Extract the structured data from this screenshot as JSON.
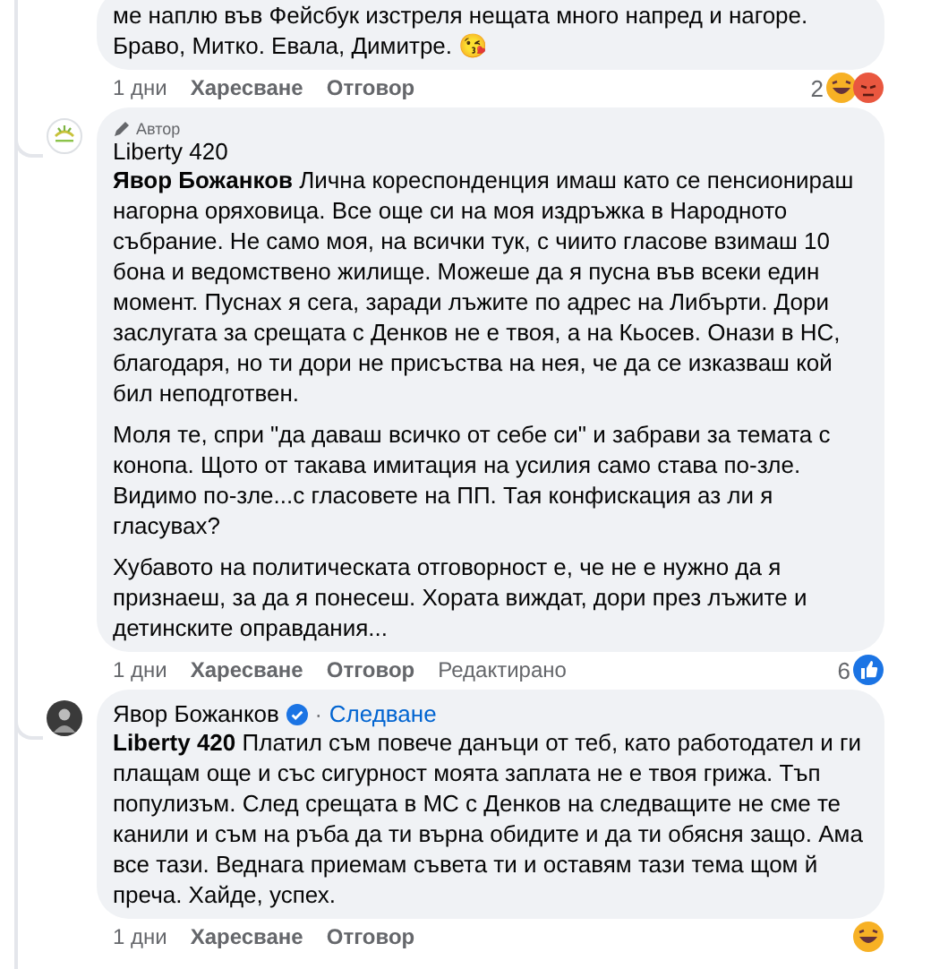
{
  "comments": [
    {
      "paragraphs": [
        "ме наплю във Фейсбук изстреля нещата много напред и нагоре. Браво, Митко. Евала, Димитре. 😘"
      ],
      "time": "1 дни",
      "like": "Харесване",
      "reply": "Отговор",
      "reaction_count": "2",
      "reactions": [
        {
          "kind": "haha"
        },
        {
          "kind": "angry"
        }
      ]
    },
    {
      "avatar": {
        "kind": "logo"
      },
      "badge": "Автор",
      "author": "Liberty 420",
      "paragraphs": [
        "**Явор Божанков** Лична кореспонденция имаш като се пенсионираш нагорна оряховица. Все още си на моя издръжка в Народното събрание. Не само моя, на всички тук, с чиито гласове взимаш 10 бона и ведомствено жилище. Можеше да я пусна във всеки един момент. Пуснах я сега, заради лъжите по адрес на Либърти. Дори заслугата за срещата с Денков не е твоя, а на Кьосев. Онази в НС, благодаря, но ти дори не присъства на нея, че да се изказваш кой бил неподготвен.",
        "Моля те, спри \"да даваш всичко от себе си\" и забрави за темата с конопа. Щото от такава имитация на усилия само става по-зле. Видимо по-зле...с гласовете на ПП. Тая конфискация аз ли я гласувах?",
        "Хубавото на политическата отговорност е, че не е нужно да я признаеш, за да я понесеш. Хората виждат, дори през лъжите и детинските оправдания..."
      ],
      "time": "1 дни",
      "like": "Харесване",
      "reply": "Отговор",
      "edited": "Редактирано",
      "reaction_count": "6",
      "reactions": [
        {
          "kind": "like"
        }
      ]
    },
    {
      "avatar": {
        "kind": "photo"
      },
      "author": "Явор Божанков",
      "verified": true,
      "separator": "·",
      "follow": "Следване",
      "paragraphs": [
        "**Liberty 420** Платил съм повече данъци от теб, като работодател и ги плащам още и със сигурност моята заплата не е твоя грижа. Тъп популизъм. След срещата в МС с Денков на следващите не сме те канили и съм на ръба да ти върна обидите и да ти обясня защо. Ама все тази. Веднага приемам съвета ти и оставям тази тема щом й преча. Хайде, успех."
      ],
      "time": "1 дни",
      "like": "Харесване",
      "reply": "Отговор",
      "reactions": [
        {
          "kind": "haha"
        }
      ]
    }
  ]
}
